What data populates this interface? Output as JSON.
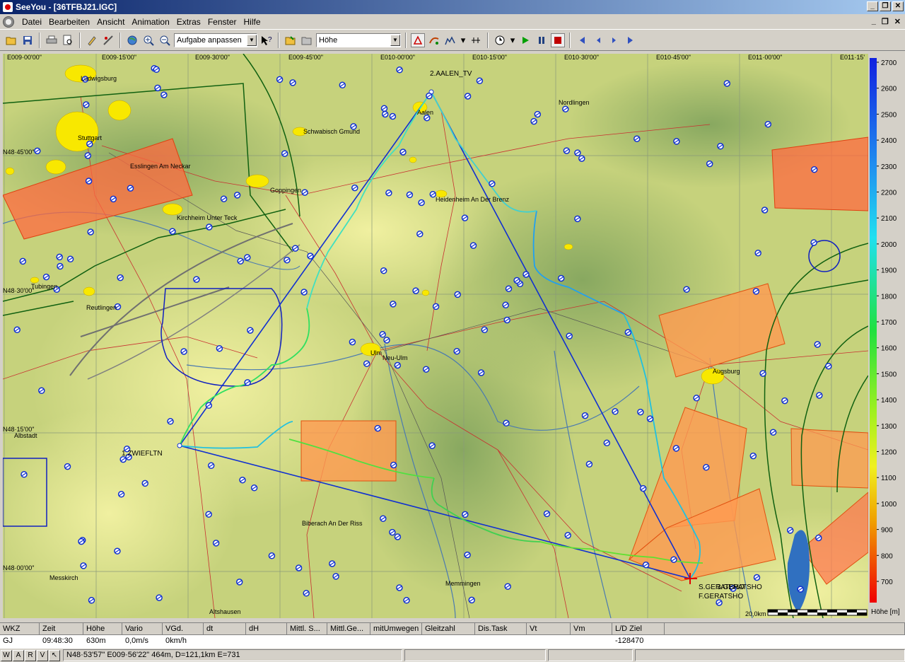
{
  "window": {
    "title": "SeeYou - [36TFBJ21.IGC]",
    "controls": [
      "_",
      "❐",
      "✕"
    ]
  },
  "menu": [
    "Datei",
    "Bearbeiten",
    "Ansicht",
    "Animation",
    "Extras",
    "Fenster",
    "Hilfe"
  ],
  "toolbar": {
    "zoom_select": "Aufgabe anpassen",
    "layer_select": "Höhe"
  },
  "map": {
    "lon_labels": [
      "E009·00'00\"",
      "E009·15'00\"",
      "E009·30'00\"",
      "E009·45'00\"",
      "E010·00'00\"",
      "E010·15'00\"",
      "E010·30'00\"",
      "E010·45'00\"",
      "E011·00'00\"",
      "E011·15'"
    ],
    "lat_labels": [
      "N48·45'00\"",
      "N48·30'00\"",
      "N48·15'00\"",
      "N48·00'00\""
    ],
    "towns": {
      "ludwigsburg": "Ludwigsburg",
      "stuttgart": "Stuttgart",
      "esslingen": "Esslingen Am Neckar",
      "schwabisch": "Schwabisch Gmund",
      "goppingen": "Goppingen",
      "kirchheim": "Kirchheim Unter Teck",
      "tubingen": "Tubingen",
      "reutlingen": "Reutlingen",
      "heidenheim": "Heidenheim An Der Brenz",
      "aalen": "Aalen",
      "nordlingen": "Nordlingen",
      "neuulm": "Neu-Ulm",
      "ulm": "Ulm",
      "augsburg": "Augsburg",
      "albstadt": "Albstadt",
      "biberach": "Biberach An Der Riss",
      "memmingen": "Memmingen",
      "messkirch": "Messkirch",
      "aulendorf": "Altshausen"
    },
    "turnpoints": {
      "tp1": "1.ZWIEFLTN",
      "tp2": "2.AALEN_TV",
      "tp3": "3.GERATSHO",
      "start": "S.GERATSHO",
      "finish": "F.GERATSHO"
    },
    "scale_label": "20,0km"
  },
  "altitude_scale": {
    "ticks": [
      "2700",
      "2600",
      "2500",
      "2400",
      "2300",
      "2200",
      "2100",
      "2000",
      "1900",
      "1800",
      "1700",
      "1600",
      "1500",
      "1400",
      "1300",
      "1200",
      "1100",
      "1000",
      "900",
      "800",
      "700"
    ],
    "label": "Höhe [m]"
  },
  "status": {
    "headers": [
      "WKZ",
      "Zeit",
      "Höhe",
      "Vario",
      "VGd.",
      "dt",
      "dH",
      "Mittl. S...",
      "Mittl.Ge...",
      "mitUmwegen",
      "Gleitzahl",
      "Dis.Task",
      "Vt",
      "Vm",
      "L/D Ziel"
    ],
    "row": [
      "GJ",
      "09:48:30",
      "630m",
      "0,0m/s",
      "0km/h",
      "",
      "",
      "",
      "",
      "",
      "",
      "",
      "",
      "",
      "-128470"
    ]
  },
  "bottom": {
    "modes": [
      "W",
      "A",
      "R",
      "V"
    ],
    "coords": "N48·53'57\"  E009·56'22\" 464m, D=121,1km E=731"
  }
}
